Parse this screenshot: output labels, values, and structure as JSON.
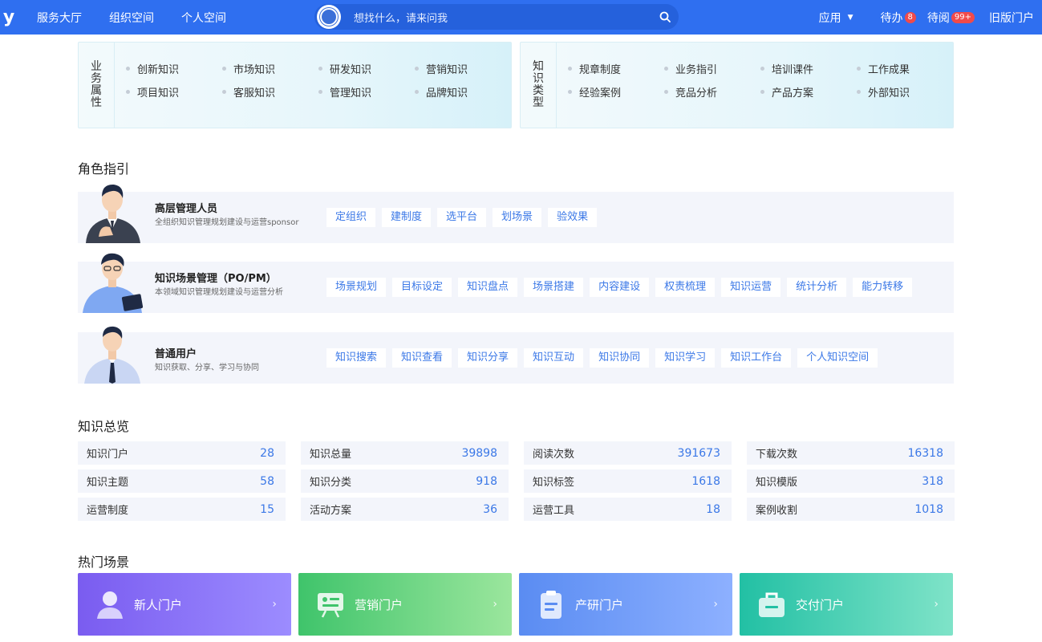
{
  "topbar": {
    "logo": "y",
    "nav": [
      "服务大厅",
      "组织空间",
      "个人空间"
    ],
    "search_placeholder": "想找什么，请来问我",
    "apps_label": "应用",
    "todo_label": "待办",
    "todo_count": "8",
    "toread_label": "待阅",
    "toread_count": "99+",
    "old_portal": "旧版门户"
  },
  "business_attrs": {
    "title": [
      "业",
      "务",
      "属",
      "性"
    ],
    "items": [
      "创新知识",
      "市场知识",
      "研发知识",
      "营销知识",
      "项目知识",
      "客服知识",
      "管理知识",
      "品牌知识"
    ]
  },
  "knowledge_types": {
    "title": [
      "知",
      "识",
      "类",
      "型"
    ],
    "items": [
      "规章制度",
      "业务指引",
      "培训课件",
      "工作成果",
      "经验案例",
      "竞品分析",
      "产品方案",
      "外部知识"
    ]
  },
  "role_guide": {
    "title": "角色指引",
    "roles": [
      {
        "name": "高层管理人员",
        "desc": "全组织知识管理规划建设与运营sponsor",
        "tags": [
          "定组织",
          "建制度",
          "选平台",
          "划场景",
          "验效果"
        ]
      },
      {
        "name": "知识场景管理（PO/PM）",
        "desc": "本领域知识管理规划建设与运营分析",
        "tags": [
          "场景规划",
          "目标设定",
          "知识盘点",
          "场景搭建",
          "内容建设",
          "权责梳理",
          "知识运营",
          "统计分析",
          "能力转移"
        ]
      },
      {
        "name": "普通用户",
        "desc": "知识获取、分享、学习与协同",
        "tags": [
          "知识搜索",
          "知识查看",
          "知识分享",
          "知识互动",
          "知识协同",
          "知识学习",
          "知识工作台",
          "个人知识空间"
        ]
      }
    ]
  },
  "overview": {
    "title": "知识总览",
    "stats": [
      {
        "label": "知识门户",
        "value": "28"
      },
      {
        "label": "知识总量",
        "value": "39898"
      },
      {
        "label": "阅读次数",
        "value": "391673"
      },
      {
        "label": "下载次数",
        "value": "16318"
      },
      {
        "label": "知识主题",
        "value": "58"
      },
      {
        "label": "知识分类",
        "value": "918"
      },
      {
        "label": "知识标签",
        "value": "1618"
      },
      {
        "label": "知识模版",
        "value": "318"
      },
      {
        "label": "运营制度",
        "value": "15"
      },
      {
        "label": "活动方案",
        "value": "36"
      },
      {
        "label": "运营工具",
        "value": "18"
      },
      {
        "label": "案例收割",
        "value": "1018"
      }
    ]
  },
  "hot_scenes": {
    "title": "热门场景",
    "cards": [
      {
        "label": "新人门户",
        "icon": "person-icon"
      },
      {
        "label": "营销门户",
        "icon": "presentation-icon"
      },
      {
        "label": "产研门户",
        "icon": "clipboard-icon"
      },
      {
        "label": "交付门户",
        "icon": "briefcase-icon"
      }
    ]
  },
  "colors": {
    "topbar": "#2f6ff0",
    "accent": "#3b78e7",
    "row_bg": "#f3f5fb"
  }
}
